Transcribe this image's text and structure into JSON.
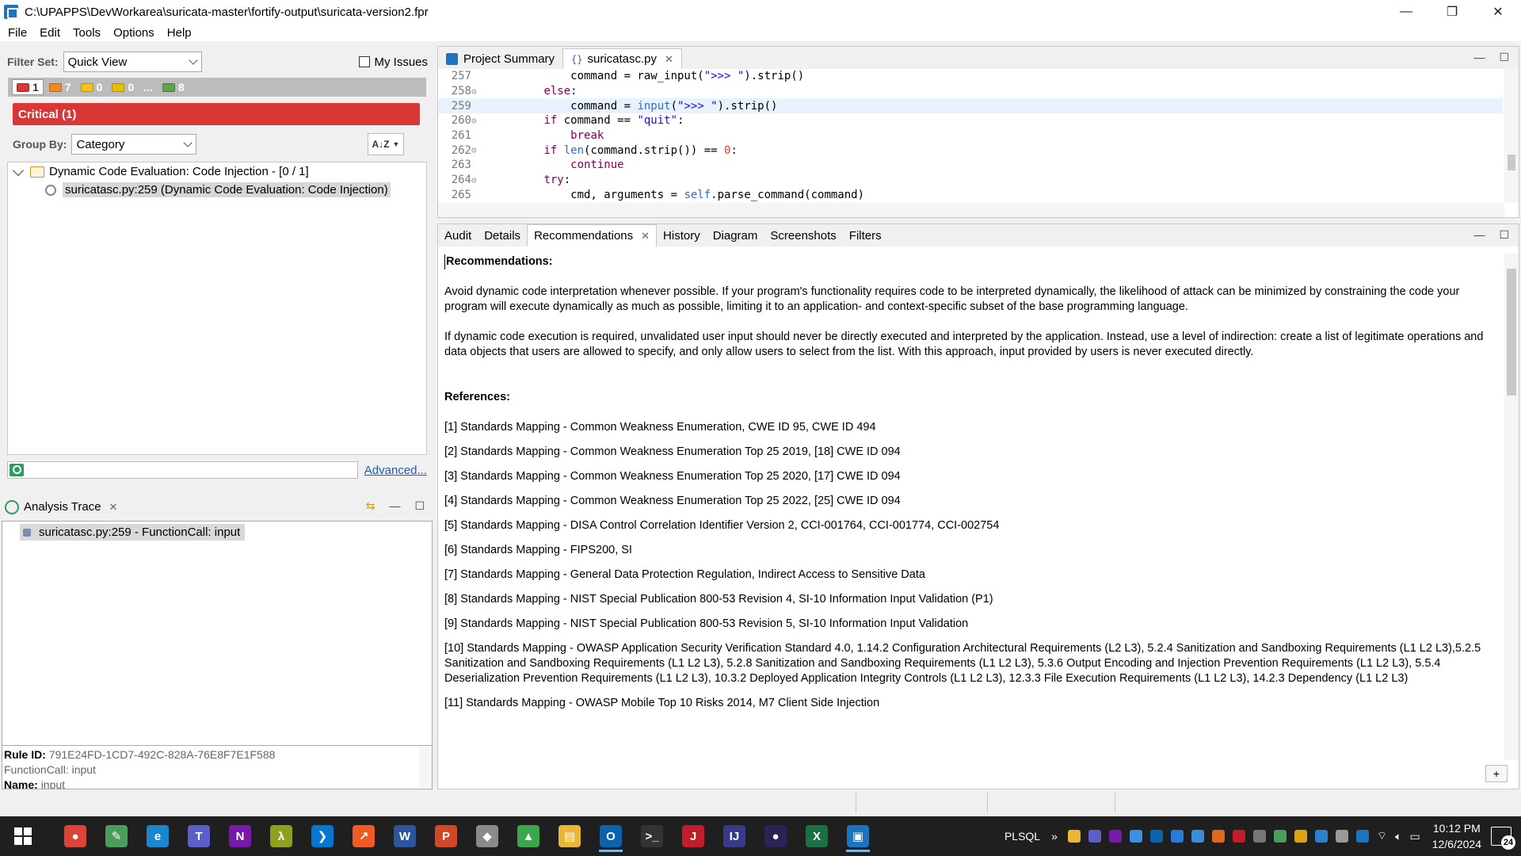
{
  "window": {
    "title": "C:\\UPAPPS\\DevWorkarea\\suricata-master\\fortify-output\\suricata-version2.fpr",
    "minimize": "—",
    "restore": "❐",
    "close": "✕"
  },
  "menu": [
    "File",
    "Edit",
    "Tools",
    "Options",
    "Help"
  ],
  "filter": {
    "label": "Filter Set:",
    "value": "Quick View",
    "my_issues_label": "My Issues"
  },
  "severity_tabs": [
    {
      "label": "1",
      "color": "#d93636"
    },
    {
      "label": "7",
      "color": "#f08a1c"
    },
    {
      "label": "0",
      "color": "#f2c318"
    },
    {
      "label": "0",
      "color": "#e6c000"
    },
    {
      "label": "..."
    },
    {
      "label": "8",
      "color": "#5ea24a"
    }
  ],
  "critical_bar": "Critical (1)",
  "group_by": {
    "label": "Group By:",
    "value": "Category",
    "sort_label": "A↓Z"
  },
  "tree": {
    "folder": "Dynamic Code Evaluation: Code Injection - [0 / 1]",
    "issue": "suricatasc.py:259 (Dynamic Code Evaluation: Code Injection)"
  },
  "search": {
    "placeholder": "",
    "advanced_link": "Advanced..."
  },
  "analysis_trace": {
    "title": "Analysis Trace",
    "item": "suricatasc.py:259 - FunctionCall: input"
  },
  "rule_info": {
    "rule_id_label": "Rule ID:",
    "rule_id": "791E24FD-1CD7-492C-828A-76E8F7E1F588",
    "function_call": "FunctionCall: input",
    "name_label": "Name:",
    "name": "input"
  },
  "editor": {
    "tabs": [
      {
        "label": "Project Summary"
      },
      {
        "label": "suricatasc.py"
      }
    ],
    "lines": [
      {
        "num": "257",
        "fold": "",
        "code": "            command = raw_input(\">>> \").strip()"
      },
      {
        "num": "258",
        "fold": "⊝",
        "code": "        else:"
      },
      {
        "num": "259",
        "fold": "",
        "code": "            command = input(\">>> \").strip()"
      },
      {
        "num": "260",
        "fold": "⊝",
        "code": "        if command == \"quit\":"
      },
      {
        "num": "261",
        "fold": "",
        "code": "            break"
      },
      {
        "num": "262",
        "fold": "⊝",
        "code": "        if len(command.strip()) == 0:"
      },
      {
        "num": "263",
        "fold": "",
        "code": "            continue"
      },
      {
        "num": "264",
        "fold": "⊝",
        "code": "        try:"
      },
      {
        "num": "265",
        "fold": "",
        "code": "            cmd, arguments = self.parse_command(command)"
      }
    ]
  },
  "detail_tabs": [
    "Audit",
    "Details",
    "Recommendations",
    "History",
    "Diagram",
    "Screenshots",
    "Filters"
  ],
  "recommendations": {
    "heading": "Recommendations:",
    "para1": "Avoid dynamic code interpretation whenever possible. If your program's functionality requires code to be interpreted dynamically, the likelihood of attack can be minimized by constraining the code your program will execute dynamically as much as possible, limiting it to an application- and context-specific subset of the base programming language.",
    "para2": "If dynamic code execution is required, unvalidated user input should never be directly executed and interpreted by the application. Instead, use a level of indirection: create a list of legitimate operations and data objects that users are allowed to specify, and only allow users to select from the list. With this approach, input provided by users is never executed directly.",
    "references_heading": "References:",
    "references": [
      "[1] Standards Mapping - Common Weakness Enumeration, CWE ID 95, CWE ID 494",
      "[2] Standards Mapping - Common Weakness Enumeration Top 25 2019, [18] CWE ID 094",
      "[3] Standards Mapping - Common Weakness Enumeration Top 25 2020, [17] CWE ID 094",
      "[4] Standards Mapping - Common Weakness Enumeration Top 25 2022, [25] CWE ID 094",
      "[5] Standards Mapping - DISA Control Correlation Identifier Version 2, CCI-001764, CCI-001774, CCI-002754",
      "[6] Standards Mapping - FIPS200, SI",
      "[7] Standards Mapping - General Data Protection Regulation, Indirect Access to Sensitive Data",
      "[8] Standards Mapping - NIST Special Publication 800-53 Revision 4, SI-10 Information Input Validation (P1)",
      "[9] Standards Mapping - NIST Special Publication 800-53 Revision 5, SI-10 Information Input Validation",
      "[10] Standards Mapping - OWASP Application Security Verification Standard 4.0, 1.14.2 Configuration Architectural Requirements (L2 L3), 5.2.4 Sanitization and Sandboxing Requirements (L1 L2 L3),5.2.5 Sanitization and Sandboxing Requirements (L1 L2 L3), 5.2.8 Sanitization and Sandboxing Requirements (L1 L2 L3), 5.3.6 Output Encoding and Injection Prevention Requirements (L1 L2 L3),  5.5.4 Deserialization Prevention Requirements (L1 L2 L3), 10.3.2 Deployed Application Integrity Controls (L1 L2 L3), 12.3.3 File Execution Requirements (L1 L2 L3), 14.2.3 Dependency (L1 L2 L3)",
      "[11] Standards Mapping - OWASP Mobile Top 10 Risks 2014, M7 Client Side Injection"
    ],
    "add_button": "+"
  },
  "taskbar": {
    "apps": [
      {
        "name": "chrome",
        "glyph": "●",
        "color": "#db4437"
      },
      {
        "name": "notepad",
        "glyph": "✎",
        "color": "#4a9d5a"
      },
      {
        "name": "edge",
        "glyph": "e",
        "color": "#1a86d0"
      },
      {
        "name": "teams",
        "glyph": "T",
        "color": "#5b5fc7"
      },
      {
        "name": "onenote",
        "glyph": "N",
        "color": "#7719aa"
      },
      {
        "name": "lambda",
        "glyph": "λ",
        "color": "#8f9f1f"
      },
      {
        "name": "vscode",
        "glyph": "❯",
        "color": "#0078d4"
      },
      {
        "name": "postman",
        "glyph": "↗",
        "color": "#ef5b25"
      },
      {
        "name": "word",
        "glyph": "W",
        "color": "#2b579a"
      },
      {
        "name": "powerpoint",
        "glyph": "P",
        "color": "#d24726"
      },
      {
        "name": "sketch",
        "glyph": "◆",
        "color": "#8a8a8a"
      },
      {
        "name": "rider",
        "glyph": "▲",
        "color": "#3ca64d"
      },
      {
        "name": "explorer",
        "glyph": "▤",
        "color": "#e8b73a"
      },
      {
        "name": "outlook",
        "glyph": "O",
        "color": "#0a64ad"
      },
      {
        "name": "terminal",
        "glyph": ">_",
        "color": "#333333"
      },
      {
        "name": "jetbrains",
        "glyph": "J",
        "color": "#c21d2b"
      },
      {
        "name": "intellij",
        "glyph": "IJ",
        "color": "#3a3a8a"
      },
      {
        "name": "eclipse",
        "glyph": "●",
        "color": "#2c2255"
      },
      {
        "name": "excel",
        "glyph": "X",
        "color": "#1d7044"
      },
      {
        "name": "fortify",
        "glyph": "▣",
        "color": "#1e73be"
      }
    ],
    "tray_label": "PLSQL",
    "time": "10:12 PM",
    "date": "12/6/2024",
    "notifications": "24"
  }
}
